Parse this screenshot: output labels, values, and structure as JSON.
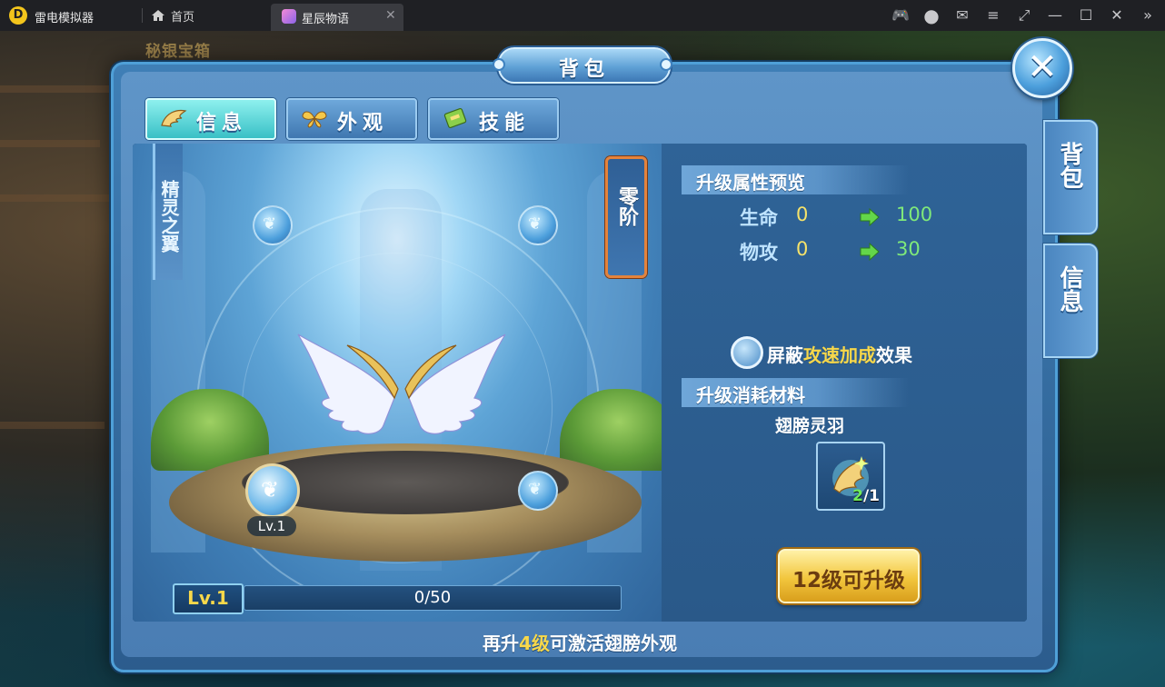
{
  "emulator": {
    "app_name": "雷电模拟器",
    "tabs": [
      {
        "label": "首页",
        "icon": "home-icon"
      },
      {
        "label": "星辰物语",
        "icon": "game-app-icon",
        "active": true
      }
    ],
    "toolbar_icons": [
      "gamepad-icon",
      "user-icon",
      "mail-icon",
      "menu-icon",
      "resize-icon",
      "minimize-icon",
      "maximize-icon",
      "close-icon",
      "collapse-icon"
    ],
    "toolbar_glyphs": [
      "🎮",
      "●",
      "✉",
      "≡",
      "⤢",
      "—",
      "☐",
      "✕",
      "»"
    ]
  },
  "scene": {
    "chest_label": "秘银宝箱"
  },
  "panel": {
    "title": "背包",
    "close_glyph": "✕",
    "tabs": [
      {
        "label": "信息",
        "icon": "wing-icon",
        "active": true
      },
      {
        "label": "外观",
        "icon": "butterfly-icon",
        "active": false
      },
      {
        "label": "技能",
        "icon": "skill-book-icon",
        "active": false
      }
    ],
    "side_tabs": [
      {
        "label": "背包"
      },
      {
        "label": "信息"
      }
    ]
  },
  "wing": {
    "category_banner": "精灵之翼",
    "grade": "零阶",
    "slot_level": "Lv.1",
    "level": "Lv.1",
    "exp_current": 0,
    "exp_max": 50,
    "exp_text": "0/50"
  },
  "info": {
    "preview_header": "升级属性预览",
    "stats": [
      {
        "name": "生命",
        "current": "0",
        "next": "100"
      },
      {
        "name": "物攻",
        "current": "0",
        "next": "30"
      }
    ],
    "toggle": {
      "prefix": "屏蔽",
      "highlight": "攻速加成",
      "suffix": "效果",
      "checked": false
    },
    "material_header": "升级消耗材料",
    "material": {
      "name": "翅膀灵羽",
      "have": "2",
      "need": "/1"
    },
    "upgrade_button": "12级可升级"
  },
  "footer": {
    "prefix": "再升",
    "highlight": "4级",
    "suffix": "可激活翅膀外观"
  },
  "colors": {
    "highlight_yellow": "#f8d84a",
    "value_green": "#7fe97a",
    "panel_blue": "#4a7db3",
    "active_tab_cyan": "#39c0c6",
    "button_gold": "#f2c63d"
  }
}
